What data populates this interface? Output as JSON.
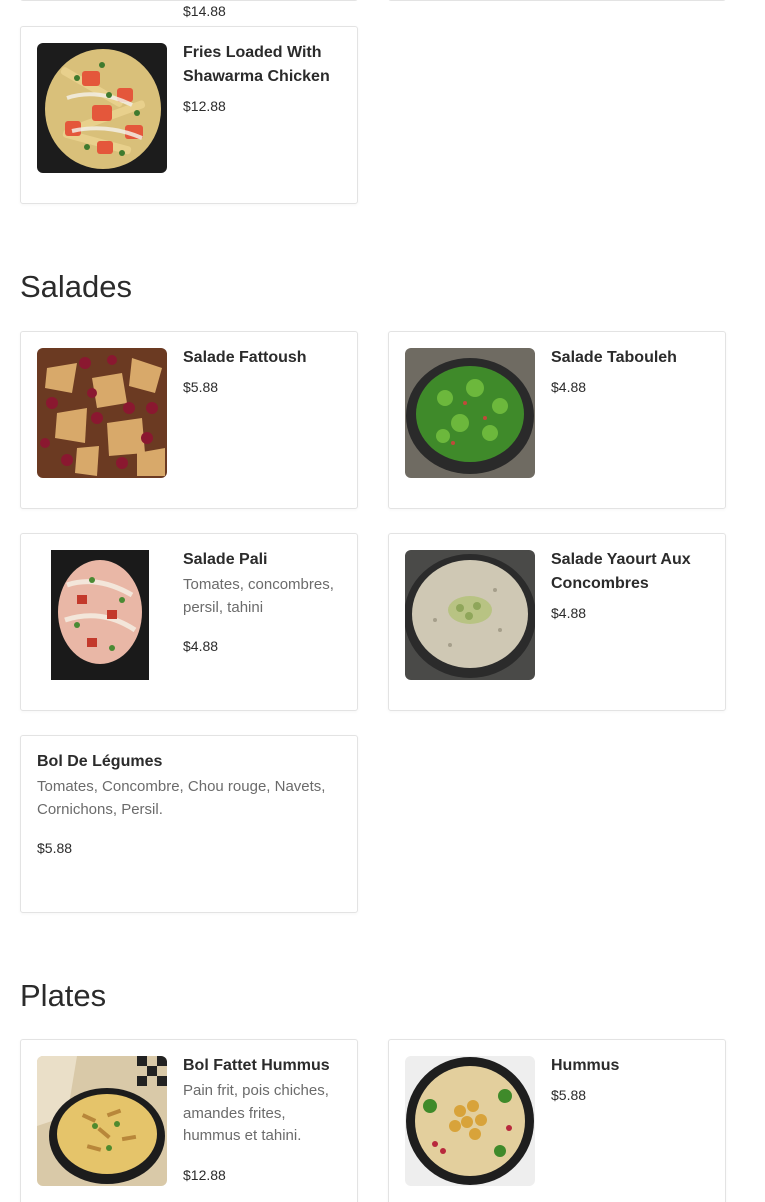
{
  "prev_section": {
    "cut_off_price": "$14.88",
    "items": [
      {
        "name": "Fries Loaded With Shawarma Chicken",
        "price": "$12.88",
        "image": "loaded-fries-photo"
      }
    ]
  },
  "salades": {
    "title": "Salades",
    "items": [
      {
        "name": "Salade Fattoush",
        "price": "$5.88",
        "image": "fattoush-photo"
      },
      {
        "name": "Salade Tabouleh",
        "price": "$4.88",
        "image": "tabouleh-photo"
      },
      {
        "name": "Salade Pali",
        "description": "Tomates, concombres, persil, tahini",
        "price": "$4.88",
        "image": "pali-salad-photo"
      },
      {
        "name": "Salade Yaourt Aux Concombres",
        "price": "$4.88",
        "image": "yogurt-cucumber-photo"
      },
      {
        "name": "Bol De Légumes",
        "description": "Tomates, Concombre, Chou rouge, Navets, Cornichons, Persil.",
        "price": "$5.88"
      }
    ]
  },
  "plates": {
    "title": "Plates",
    "items": [
      {
        "name": "Bol Fattet Hummus",
        "description": "Pain frit, pois chiches, amandes frites, hummus et tahini.",
        "price": "$12.88",
        "image": "fattet-hummus-photo"
      },
      {
        "name": "Hummus",
        "price": "$5.88",
        "image": "hummus-photo"
      }
    ]
  }
}
